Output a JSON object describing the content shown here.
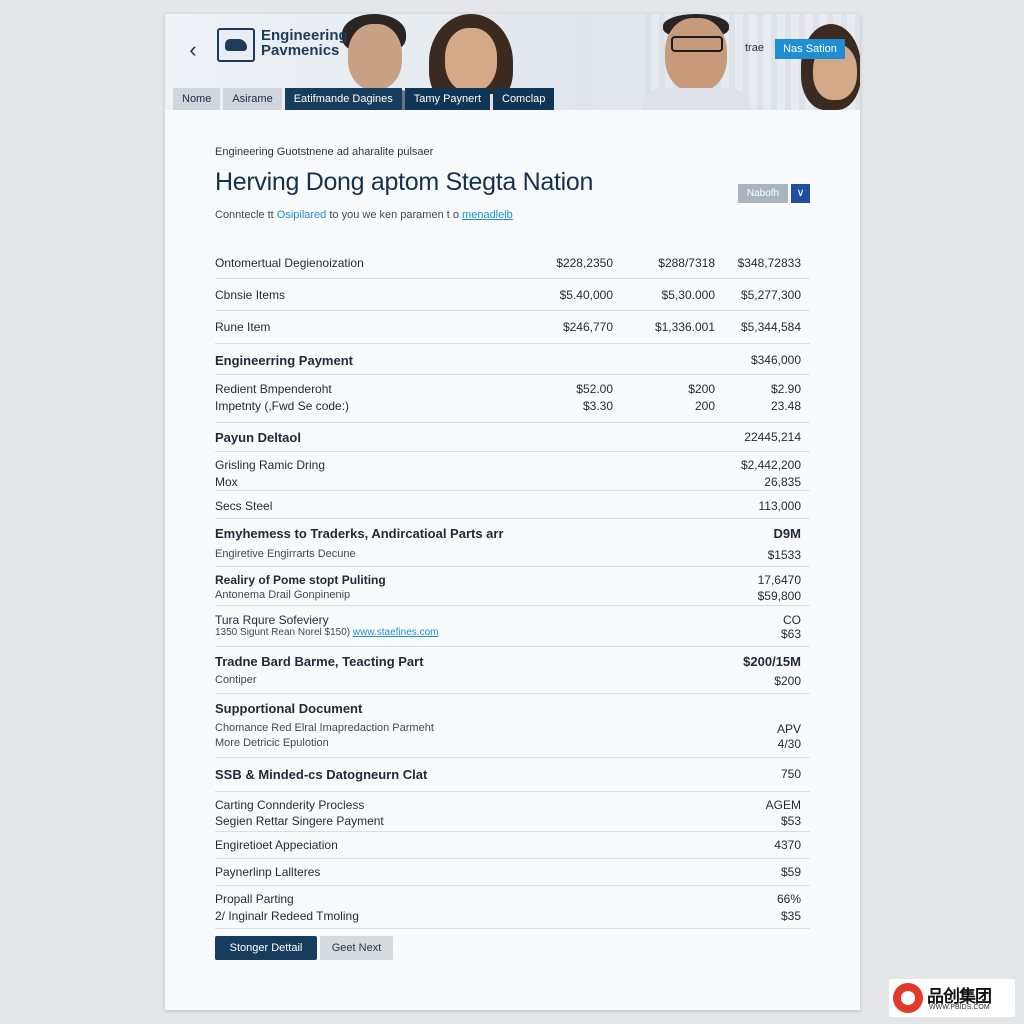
{
  "header": {
    "logo_line1": "Engineering",
    "logo_line2": "Pavmenics",
    "link_label": "trae",
    "button_label": "Nas Sation"
  },
  "tabs": [
    {
      "label": "Nome"
    },
    {
      "label": "Asirame"
    },
    {
      "label": "Eatifmande Dagines"
    },
    {
      "label": "Tamy Paynert"
    },
    {
      "label": "Comclap"
    }
  ],
  "content": {
    "eyebrow": "Engineering Guotstnene ad aharalite pulsaer",
    "title": "Herving Dong aptom Stegta Nation",
    "subtitle_prefix": "Conntecle tt ",
    "subtitle_link": "Osipilared",
    "subtitle_mid": " to you we ken paramen t o ",
    "subtitle_link2": "menadlelb",
    "select_label": "Nabofh",
    "select_chevron": "∨"
  },
  "table": {
    "rows": [
      {
        "label": "Ontomertual Degienoization",
        "c1": "$228,2350",
        "c2": "$288/7318",
        "c3": "$348,72833"
      },
      {
        "label": "Cbnsie Items",
        "c1": "$5.40,000",
        "c2": "$5,30.000",
        "c3": "$5,277,300"
      },
      {
        "label": "Rune Item",
        "c1": "$246,770",
        "c2": "$1,336.001",
        "c3": "$5,344,584"
      },
      {
        "label": "Engineerring Payment",
        "c3": "$346,000"
      },
      {
        "label": "Redient Bmpenderoht",
        "label2": "Impetnty (,Fwd Se code:)",
        "c1": "$52.00",
        "c1b": "$3.30",
        "c2": "$200",
        "c2b": "200",
        "c3": "$2.90",
        "c3b": "23.48"
      },
      {
        "label": "Payun Deltaol",
        "c3": "22445,214"
      },
      {
        "label": "Grisling Ramic Dring",
        "label2": "Mox",
        "c3": "$2,442,200",
        "c3b": "26,835"
      },
      {
        "label": "Secs Steel",
        "c3": "113,000"
      },
      {
        "label": "Emyhemess to Traderks, Andircatioal Parts arr",
        "c3": "D9M"
      },
      {
        "label": "Engiretive Engirrarts Decune",
        "c3": "$1533"
      },
      {
        "label": "Realiry of Pome stopt Puliting",
        "label2": "Antonema Drail Gonpinenip",
        "c3": "17,6470",
        "c3b": "$59,800"
      },
      {
        "label": "Tura Rqure Sofeviery",
        "label2": "1350 Sigunt Rean Norel $150)",
        "link2": "www.staefines.com",
        "c3": "CO",
        "c3b": "$63"
      },
      {
        "label": "Tradne Bard Barme, Teacting Part",
        "label2": "Contiper",
        "c3": "$200/15M",
        "c3b": "$200"
      },
      {
        "label": "Supportional Document",
        "label2": "Chomance Red Elral Imapredaction Parmeht",
        "label3": "More Detricic Epulotion",
        "c3": "APV",
        "c3b": "4/30"
      },
      {
        "label": "SSB & Minded-cs Datogneurn Clat",
        "c3": "750"
      },
      {
        "label": "Carting Connderity Procless",
        "label2": "Segien Rettar Singere Payment",
        "c3": "AGEM",
        "c3b": "$53"
      },
      {
        "label": "Engiretioet Appeciation",
        "c3": "4370"
      },
      {
        "label": "Paynerlinp Lallteres",
        "c3": "$59"
      },
      {
        "label": "Propall Parting",
        "label2": "2/ Inginalr Redeed Tmoling",
        "c3": "66%",
        "c3b": "$35"
      }
    ]
  },
  "actions": {
    "primary_label": "Stonger Dettail",
    "secondary_label": "Geet Next"
  },
  "watermark": {
    "text": "品创集团",
    "sub": "WWW.PBIDS.COM"
  }
}
